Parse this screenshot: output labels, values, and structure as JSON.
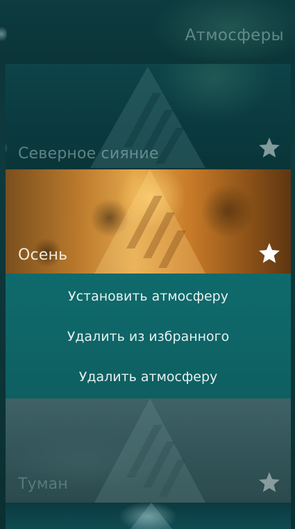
{
  "header": {
    "title": "Атмосферы"
  },
  "ambiences": [
    {
      "name": "Северное сияние",
      "favorite_icon": "star-icon",
      "favorite_color": "#b8c6c6"
    },
    {
      "name": "Осень",
      "favorite_icon": "star-icon",
      "favorite_color": "#ffffff"
    },
    {
      "name": "Туман",
      "favorite_icon": "star-icon",
      "favorite_color": "#b8c6c6"
    }
  ],
  "context_menu": {
    "items": [
      {
        "label": "Установить атмосферу"
      },
      {
        "label": "Удалить из избранного"
      },
      {
        "label": "Удалить атмосферу"
      }
    ],
    "background": "#0f6567"
  }
}
